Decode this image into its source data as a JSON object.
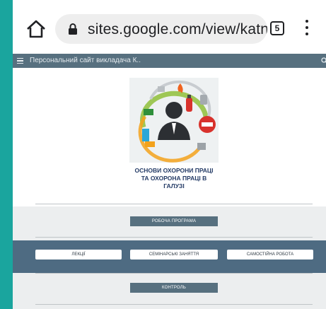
{
  "browser": {
    "url": "sites.google.com/view/katn",
    "tab_count": "5"
  },
  "site": {
    "title": "Персональний сайт викладача К.."
  },
  "course": {
    "title_lines": [
      "ОСНОВИ ОХОРОНИ ПРАЦІ",
      "ТА ОХОРОНА ПРАЦІ В",
      "ГАЛУЗІ"
    ]
  },
  "buttons": {
    "program": "РОБОЧА ПРОГРАМА",
    "lectures": "ЛЕКЦІЇ",
    "seminars": "СЕМІНАРСЬКІ ЗАНЯТТЯ",
    "independent": "САМОСТІЙНА РОБОТА",
    "control": "КОНТРОЛЬ"
  },
  "colors": {
    "background_teal": "#1aa59e",
    "nav_bar": "#57707f",
    "blue_band": "#4e6b82",
    "gray_band": "#eceeef",
    "title_blue": "#243b66"
  },
  "icons": [
    "home-icon",
    "lock-icon",
    "tabs-icon",
    "more-vert-icon",
    "hamburger-icon",
    "search-icon",
    "safety-logo"
  ]
}
